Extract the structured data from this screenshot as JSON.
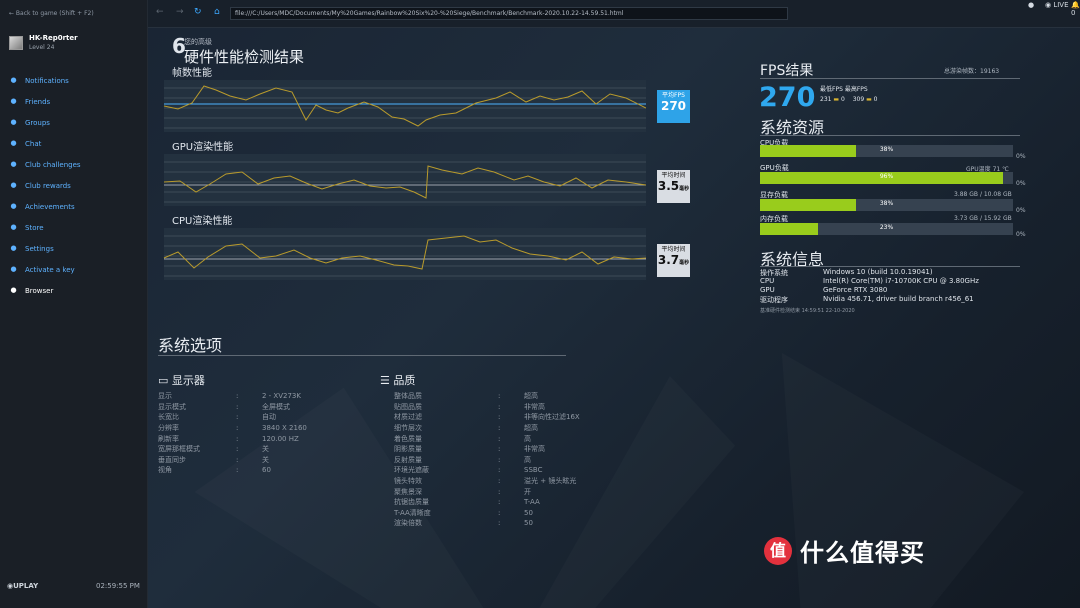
{
  "sidebar": {
    "back": "← Back to game (Shift + F2)",
    "username": "HK-Rep0rter",
    "level": "Level 24",
    "items": [
      {
        "icon": "bell-icon",
        "label": "Notifications"
      },
      {
        "icon": "friends-icon",
        "label": "Friends"
      },
      {
        "icon": "groups-icon",
        "label": "Groups"
      },
      {
        "icon": "chat-icon",
        "label": "Chat"
      },
      {
        "icon": "trophy-icon",
        "label": "Club challenges"
      },
      {
        "icon": "reward-icon",
        "label": "Club rewards"
      },
      {
        "icon": "achievement-icon",
        "label": "Achievements"
      },
      {
        "icon": "store-icon",
        "label": "Store"
      },
      {
        "icon": "settings-icon",
        "label": "Settings"
      },
      {
        "icon": "key-icon",
        "label": "Activate a key"
      },
      {
        "icon": "browser-icon",
        "label": "Browser"
      }
    ],
    "brand": "UPLAY",
    "time": "02:59:55 PM"
  },
  "topbar": {
    "url": "file:///C:/Users/MDC/Documents/My%20Games/Rainbow%20Six%20-%20Siege/Benchmark/Benchmark-2020.10.22-14.59.51.html",
    "live": "LIVE",
    "notif_count": "0"
  },
  "benchmark": {
    "small_title": "您的高级",
    "title": "硬件性能检测结果",
    "charts": [
      {
        "title": "帧数性能",
        "avg_label": "平均FPS",
        "avg_value": "270",
        "avg_unit": ""
      },
      {
        "title": "GPU渲染性能",
        "avg_label": "平均时间",
        "avg_value": "3.5",
        "avg_unit": "毫秒"
      },
      {
        "title": "CPU渲染性能",
        "avg_label": "平均时间",
        "avg_value": "3.7",
        "avg_unit": "毫秒"
      }
    ],
    "system_options": {
      "title": "系统选项",
      "display": {
        "title": "显示器",
        "rows": [
          {
            "k": "显示",
            "v": "2 - XV273K"
          },
          {
            "k": "显示模式",
            "v": "全屏模式"
          },
          {
            "k": "长宽比",
            "v": "自动"
          },
          {
            "k": "分辨率",
            "v": "3840 X 2160"
          },
          {
            "k": "刷新率",
            "v": "120.00 HZ"
          },
          {
            "k": "宽屏那框模式",
            "v": "关"
          },
          {
            "k": "垂直同步",
            "v": "关"
          },
          {
            "k": "视角",
            "v": "60"
          }
        ]
      },
      "quality": {
        "title": "品质",
        "rows": [
          {
            "k": "整体品质",
            "v": "超高"
          },
          {
            "k": "贴图品质",
            "v": "非常高"
          },
          {
            "k": "材质过滤",
            "v": "非等向性过滤16X"
          },
          {
            "k": "细节层次",
            "v": "超高"
          },
          {
            "k": "着色质量",
            "v": "高"
          },
          {
            "k": "阴影质量",
            "v": "非常高"
          },
          {
            "k": "反射质量",
            "v": "高"
          },
          {
            "k": "环境光遮蔽",
            "v": "SSBC"
          },
          {
            "k": "镜头特效",
            "v": "溢光 + 镜头眩光"
          },
          {
            "k": "聚焦景深",
            "v": "开"
          },
          {
            "k": "抗锯齿质量",
            "v": "T-AA"
          },
          {
            "k": "T-AA清晰度",
            "v": "50"
          },
          {
            "k": "渲染倍数",
            "v": "50"
          }
        ]
      }
    },
    "fps": {
      "title": "FPS结果",
      "total_label": "总游染帧数：19163",
      "value": "270",
      "min_label": "最低FPS",
      "max_label": "最高FPS",
      "min_value": "231",
      "max_value": "309"
    },
    "resources": {
      "title": "系统资源",
      "items": [
        {
          "label": "CPU负载",
          "percent": 38,
          "text": "38%",
          "right": "0%",
          "extra": ""
        },
        {
          "label": "GPU负载",
          "percent": 96,
          "text": "96%",
          "right": "0%",
          "extra": "GPU温度 71 ℃"
        },
        {
          "label": "显存负载",
          "percent": 38,
          "text": "38%",
          "right": "0%",
          "extra": "3.88 GB / 10.08 GB"
        },
        {
          "label": "内存负载",
          "percent": 23,
          "text": "23%",
          "right": "0%",
          "extra": "3.73 GB / 15.92 GB"
        }
      ]
    },
    "system": {
      "title": "系统信息",
      "rows": [
        {
          "k": "操作系统",
          "v": "Windows 10 (build 10.0.19041)"
        },
        {
          "k": "CPU",
          "v": "Intel(R) Core(TM) i7-10700K CPU @ 3.80GHz"
        },
        {
          "k": "GPU",
          "v": "GeForce RTX 3080"
        },
        {
          "k": "驱动程序",
          "v": "Nvidia 456.71, driver build branch r456_61"
        }
      ],
      "footer": "基准硬件检测结束 14:59:51 22-10-2020"
    }
  },
  "watermark": {
    "symbol": "值",
    "text": "什么值得买"
  }
}
